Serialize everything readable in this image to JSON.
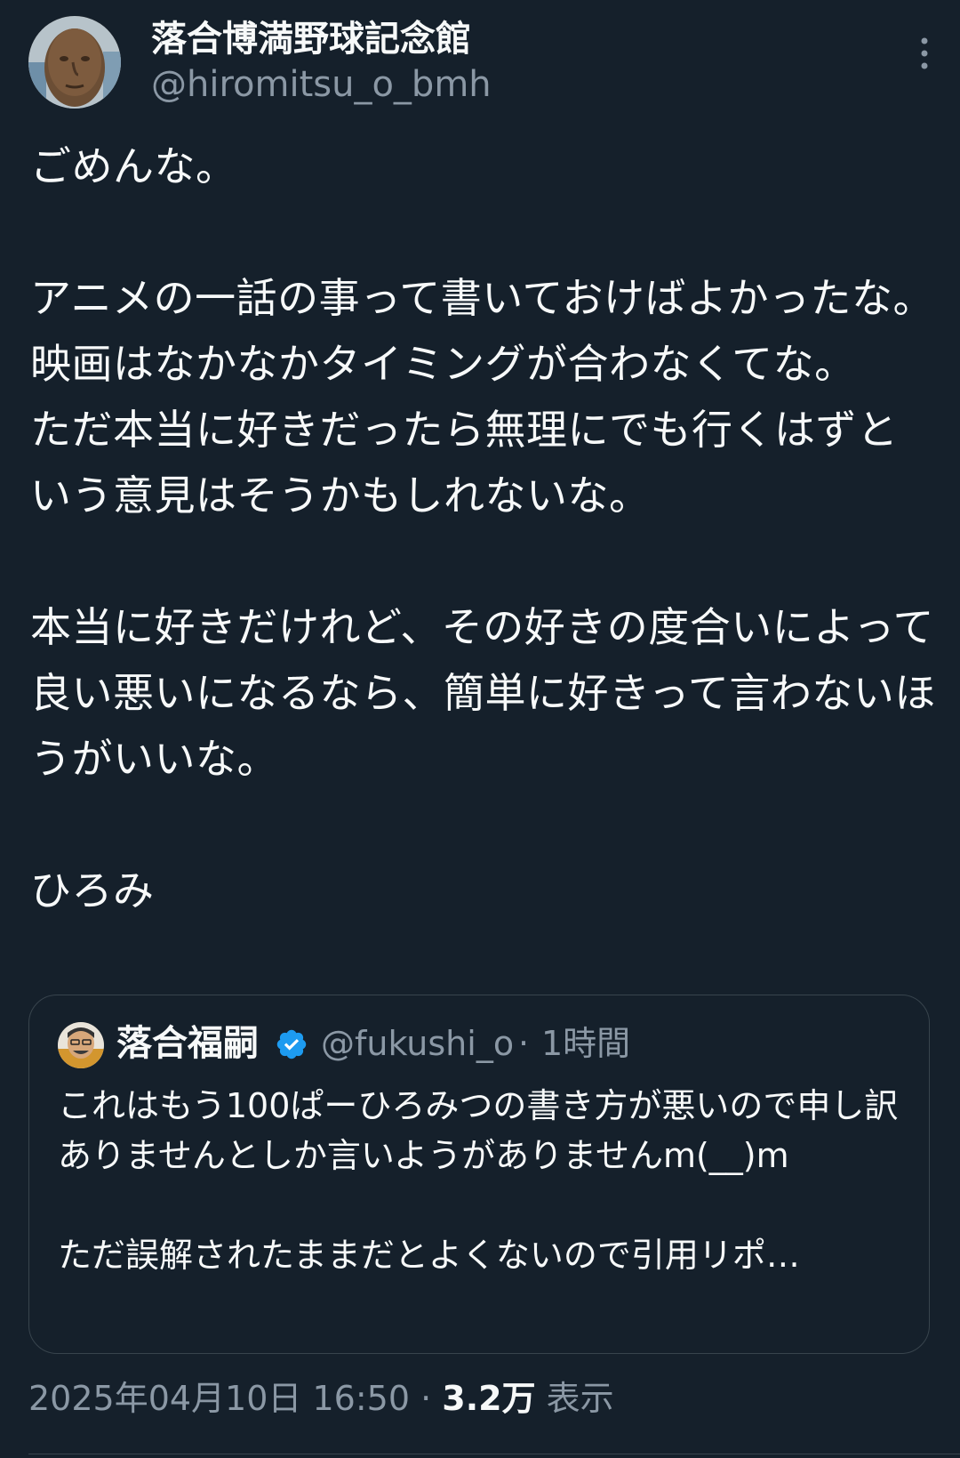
{
  "author": {
    "name": "落合博満野球記念館",
    "handle": "@hiromitsu_o_bmh"
  },
  "tweet": {
    "text": "ごめんな。\n\nアニメの一話の事って書いておけばよかったな。\n映画はなかなかタイミングが合わなくてな。\nただ本当に好きだったら無理にでも行くはずという意見はそうかもしれないな。\n\n本当に好きだけれど、その好きの度合いによって良い悪いになるなら、簡単に好きって言わないほうがいいな。\n\nひろみ"
  },
  "quoted": {
    "name": "落合福嗣",
    "handle": "@fukushi_o",
    "separator": "·",
    "time": "1時間",
    "text": "これはもう100ぱーひろみつの書き方が悪いので申し訳ありませんとしか言いようがありませんm(__)m\n\nただ誤解されたままだとよくないので引用リポ…"
  },
  "meta": {
    "datetime": "2025年04月10日 16:50",
    "separator": " · ",
    "views_count": "3.2万",
    "views_label": " 表示"
  },
  "icons": {
    "more": "more-vertical-icon",
    "verified": "verified-badge-icon"
  },
  "colors": {
    "background": "#15202b",
    "text": "#f7f9f9",
    "secondary_text": "#8b98a5",
    "border": "#38444d",
    "verified": "#1d9bf0"
  }
}
